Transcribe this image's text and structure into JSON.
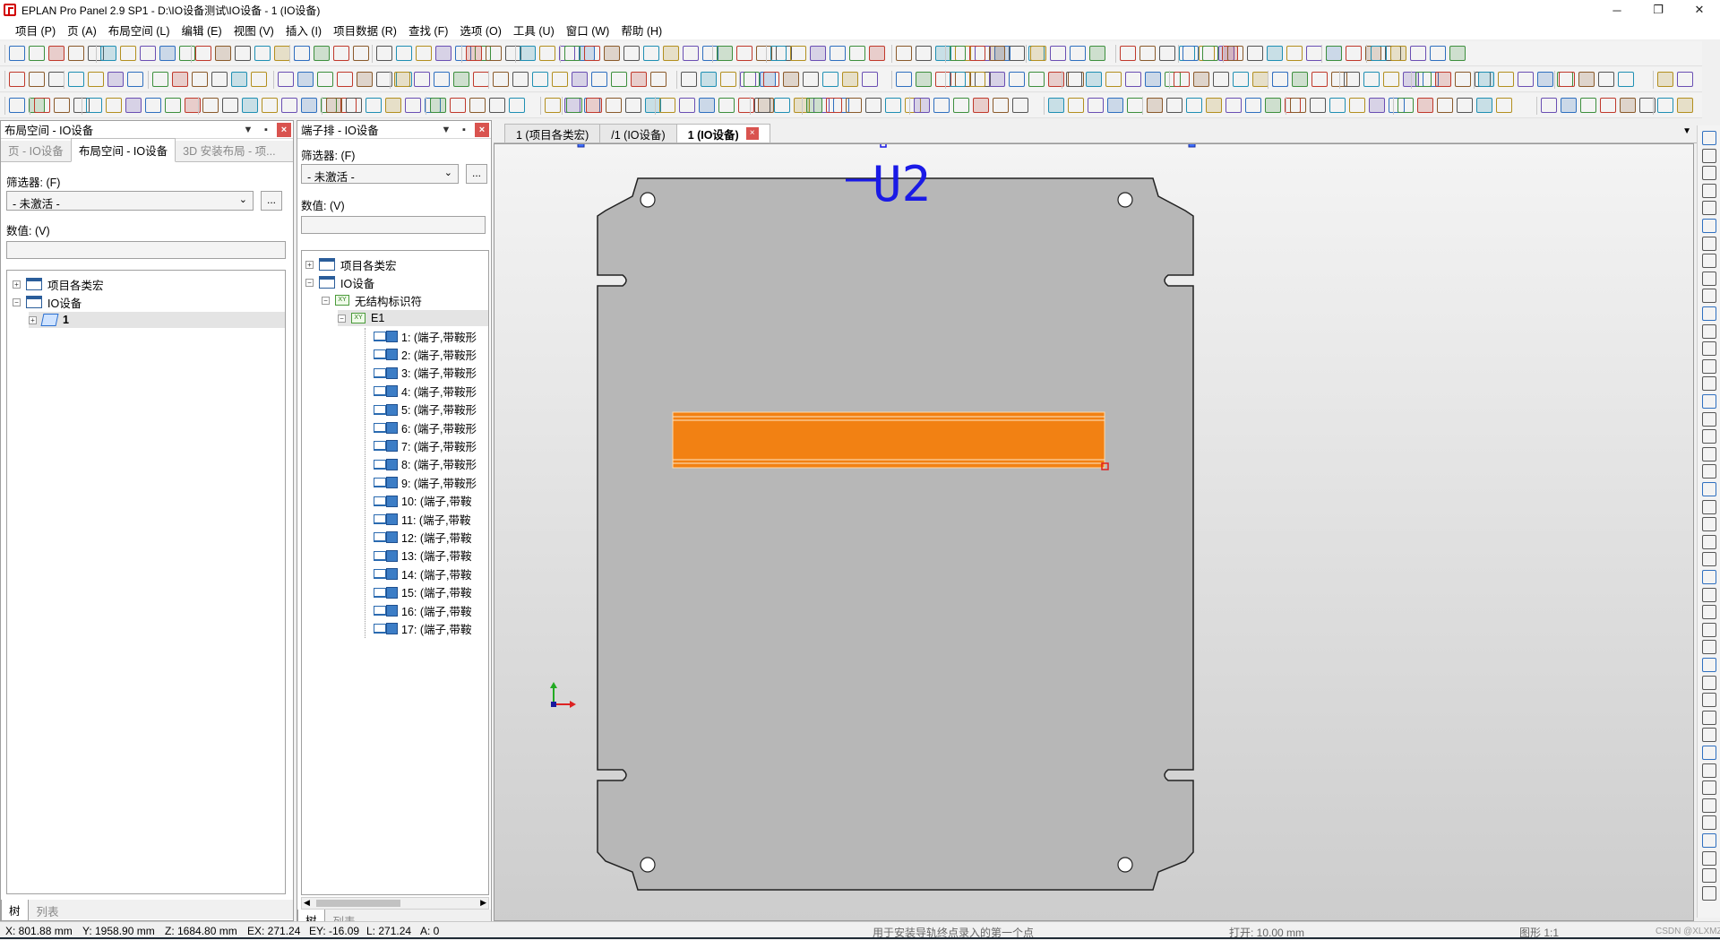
{
  "window": {
    "title": "EPLAN Pro Panel 2.9 SP1 - D:\\IO设备测试\\IO设备 - 1 (IO设备)",
    "controls": [
      "─",
      "❐",
      "✕"
    ]
  },
  "menu": [
    "项目 (P)",
    "页 (A)",
    "布局空间 (L)",
    "编辑 (E)",
    "视图 (V)",
    "插入 (I)",
    "项目数据 (R)",
    "查找 (F)",
    "选项 (O)",
    "工具 (U)",
    "窗口 (W)",
    "帮助 (H)"
  ],
  "layout_panel": {
    "title": "布局空间 - IO设备",
    "tabs": [
      "页 - IO设备",
      "布局空间 - IO设备",
      "3D 安装布局 - 项..."
    ],
    "filter_label": "筛选器: (F)",
    "filter_value": "- 未激活 -",
    "filter_btn": "...",
    "value_label": "数值: (V)",
    "value": "",
    "tree": [
      {
        "label": "项目各类宏",
        "expander": "+",
        "icon": "node"
      },
      {
        "label": "IO设备",
        "expander": "−",
        "icon": "node"
      },
      {
        "label": "1",
        "expander": "+",
        "icon": "page",
        "selected": true
      }
    ],
    "bottom_tabs": [
      "树",
      "列表"
    ]
  },
  "terminal_panel": {
    "title": "端子排 - IO设备",
    "filter_label": "筛选器: (F)",
    "filter_value": "- 未激活 -",
    "filter_btn": "...",
    "value_label": "数值: (V)",
    "value": "",
    "tree_roots": [
      {
        "label": "项目各类宏",
        "expander": "+"
      },
      {
        "label": "IO设备",
        "expander": "−"
      },
      {
        "label": "无结构标识符",
        "expander": "−",
        "icon": "XY"
      },
      {
        "label": "E1",
        "expander": "−",
        "icon": "XY"
      }
    ],
    "terminals": [
      "1: (端子,带鞍形",
      "2: (端子,带鞍形",
      "3: (端子,带鞍形",
      "4: (端子,带鞍形",
      "5: (端子,带鞍形",
      "6: (端子,带鞍形",
      "7: (端子,带鞍形",
      "8: (端子,带鞍形",
      "9: (端子,带鞍形",
      "10: (端子,带鞍",
      "11: (端子,带鞍",
      "12: (端子,带鞍",
      "13: (端子,带鞍",
      "14: (端子,带鞍",
      "15: (端子,带鞍",
      "16: (端子,带鞍",
      "17: (端子,带鞍"
    ],
    "bottom_tabs": [
      "树",
      "列表"
    ]
  },
  "doc_tabs": [
    {
      "label": "1 (项目各类宏)",
      "active": false
    },
    {
      "label": "/1 (IO设备)",
      "active": false
    },
    {
      "label": "1 (IO设备)",
      "active": true
    }
  ],
  "doc_tab_close": "×",
  "canvas": {
    "device_label": "U2",
    "colors": {
      "plate": "#b7b7b7",
      "background": "#d5d5d5",
      "rail": "#f28113",
      "label": "#1a1ae6"
    }
  },
  "status": {
    "x": "X: 801.88 mm",
    "y": "Y: 1958.90 mm",
    "z": "Z: 1684.80 mm",
    "ex": "EX: 271.24",
    "ey": "EY: -16.09",
    "l": "L: 271.24",
    "a": "A: 0",
    "hint": "用于安装导轨终点录入的第一个点",
    "open": "打开: 10.00 mm",
    "scale": "图形 1:1",
    "watermark": "CSDN @XLXMZ1"
  }
}
